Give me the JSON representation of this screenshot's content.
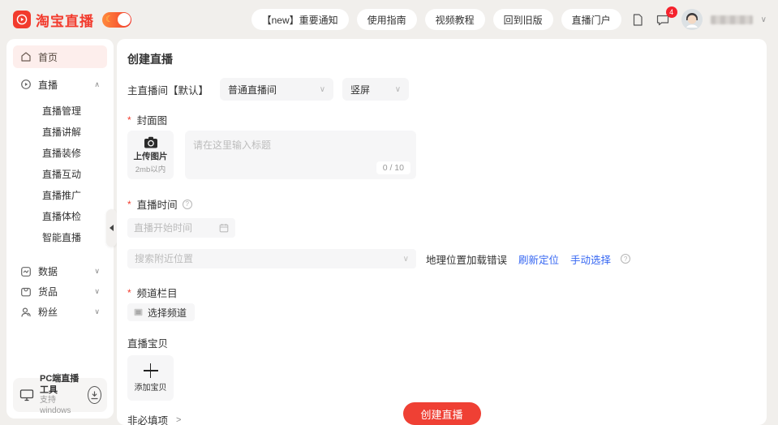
{
  "brand": {
    "logo_text": "淘宝直播",
    "brand_color": "#f23b2d"
  },
  "header": {
    "nav_buttons": [
      {
        "label": "【new】重要通知"
      },
      {
        "label": "使用指南"
      },
      {
        "label": "视频教程"
      },
      {
        "label": "回到旧版"
      },
      {
        "label": "直播门户"
      }
    ],
    "message_badge_count": "4"
  },
  "sidebar": {
    "items": [
      {
        "label": "首页",
        "icon": "home-icon",
        "active": true
      },
      {
        "label": "直播",
        "icon": "live-icon",
        "expanded": true,
        "children": [
          "直播管理",
          "直播讲解",
          "直播装修",
          "直播互动",
          "直播推广",
          "直播体检",
          "智能直播"
        ]
      },
      {
        "label": "数据",
        "icon": "data-icon"
      },
      {
        "label": "货品",
        "icon": "goods-icon"
      },
      {
        "label": "粉丝",
        "icon": "fans-icon"
      }
    ],
    "pc_tool": {
      "title": "PC端直播工具",
      "subtitle": "支持windows"
    }
  },
  "main": {
    "title": "创建直播",
    "room": {
      "label": "主直播间【默认】",
      "type_value": "普通直播间",
      "orientation_value": "竖屏"
    },
    "cover": {
      "label": "封面图",
      "upload_label": "上传图片",
      "upload_hint": "2mb以内",
      "title_placeholder": "请在这里输入标题",
      "counter": "0 / 10"
    },
    "time": {
      "label": "直播时间",
      "placeholder": "直播开始时间"
    },
    "location": {
      "placeholder": "搜索附近位置",
      "status_text": "地理位置加载错误",
      "refresh_label": "刷新定位",
      "manual_label": "手动选择"
    },
    "channel": {
      "label": "频道栏目",
      "button_label": "选择频道"
    },
    "goods": {
      "label": "直播宝贝",
      "add_label": "添加宝贝"
    },
    "optional_label": "非必填项",
    "submit_label": "创建直播"
  },
  "colors": {
    "link_blue": "#3566f2",
    "input_bg": "#f6f6f7",
    "active_bg": "#fdeeec"
  }
}
